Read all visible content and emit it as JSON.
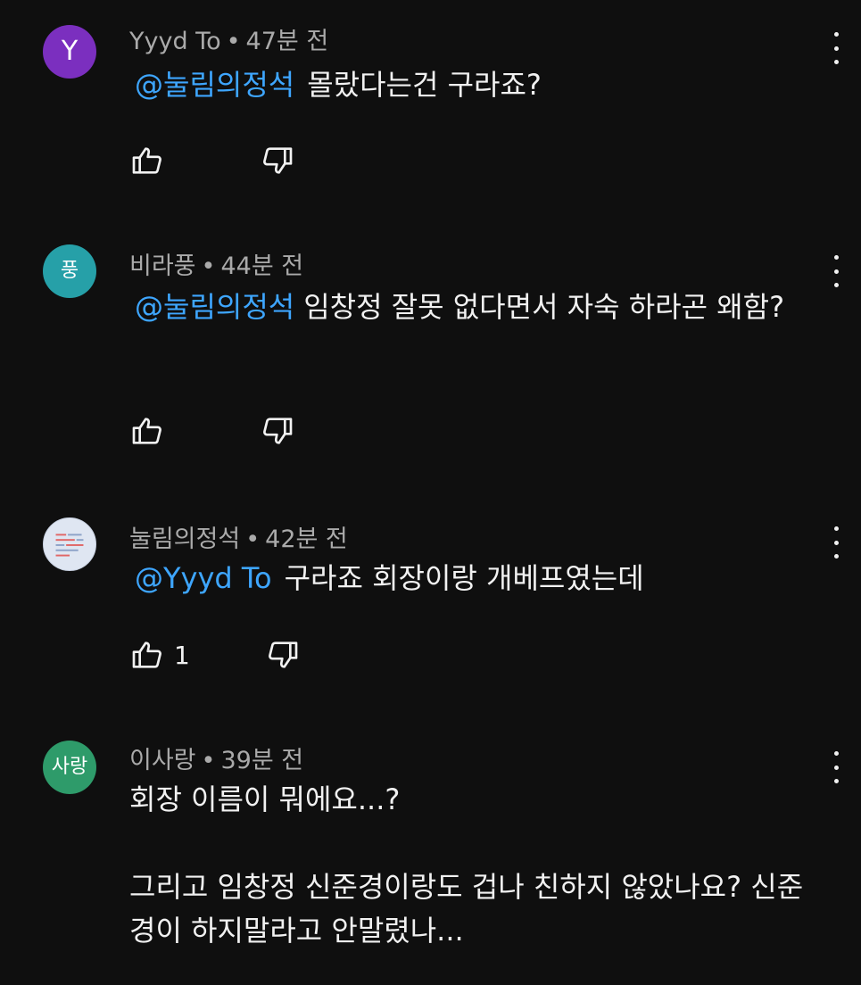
{
  "comments": [
    {
      "avatar_text": "Y",
      "avatar_color": "#7b2fbf",
      "author": "Yyyd To",
      "time": "47분 전",
      "mention": "@눌림의정석",
      "text": "몰랐다는건 구라죠?",
      "like_count": ""
    },
    {
      "avatar_text": "풍",
      "avatar_color": "#26a0a8",
      "author": "비라풍",
      "time": "44분 전",
      "mention": "@눌림의정석",
      "text": "임창정 잘못 없다면서 자숙 하라곤 왜함?",
      "like_count": ""
    },
    {
      "avatar_text": "",
      "avatar_color": "#dfe6f2",
      "author": "눌림의정석",
      "time": "42분 전",
      "mention": "@Yyyd To",
      "text": "구라죠 회장이랑 개베프였는데",
      "like_count": "1"
    },
    {
      "avatar_text": "사랑",
      "avatar_color": "#2e9b6a",
      "author": "이사랑",
      "time": "39분 전",
      "paragraphs": [
        "회장 이름이 뭐에요...?",
        "그리고 임창정 신준경이랑도 겁나 친하지 않았나요? 신준경이 하지말라고 안말렸나..."
      ]
    }
  ],
  "separator": "•",
  "icons": {
    "like": "thumbs-up-icon",
    "dislike": "thumbs-down-icon",
    "menu": "more-vert-icon"
  }
}
